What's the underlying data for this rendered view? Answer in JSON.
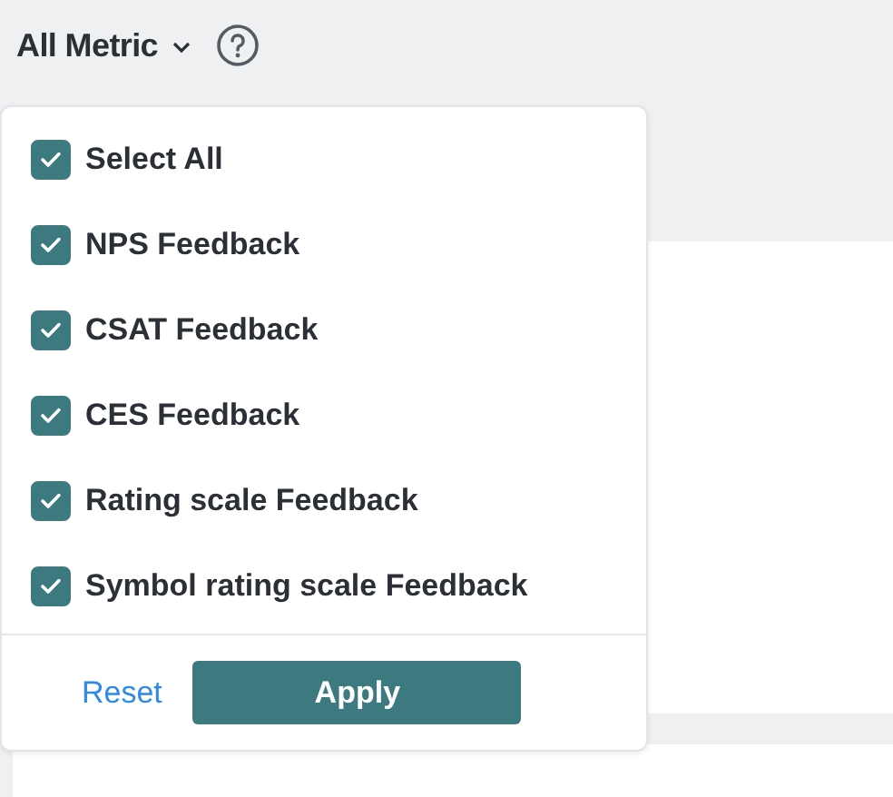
{
  "filter": {
    "label": "All Metric",
    "expanded": true
  },
  "options": [
    {
      "label": "Select All",
      "checked": true
    },
    {
      "label": "NPS Feedback",
      "checked": true
    },
    {
      "label": "CSAT Feedback",
      "checked": true
    },
    {
      "label": "CES Feedback",
      "checked": true
    },
    {
      "label": "Rating scale Feedback",
      "checked": true
    },
    {
      "label": "Symbol rating scale Feedback",
      "checked": true
    }
  ],
  "buttons": {
    "reset": "Reset",
    "apply": "Apply"
  }
}
